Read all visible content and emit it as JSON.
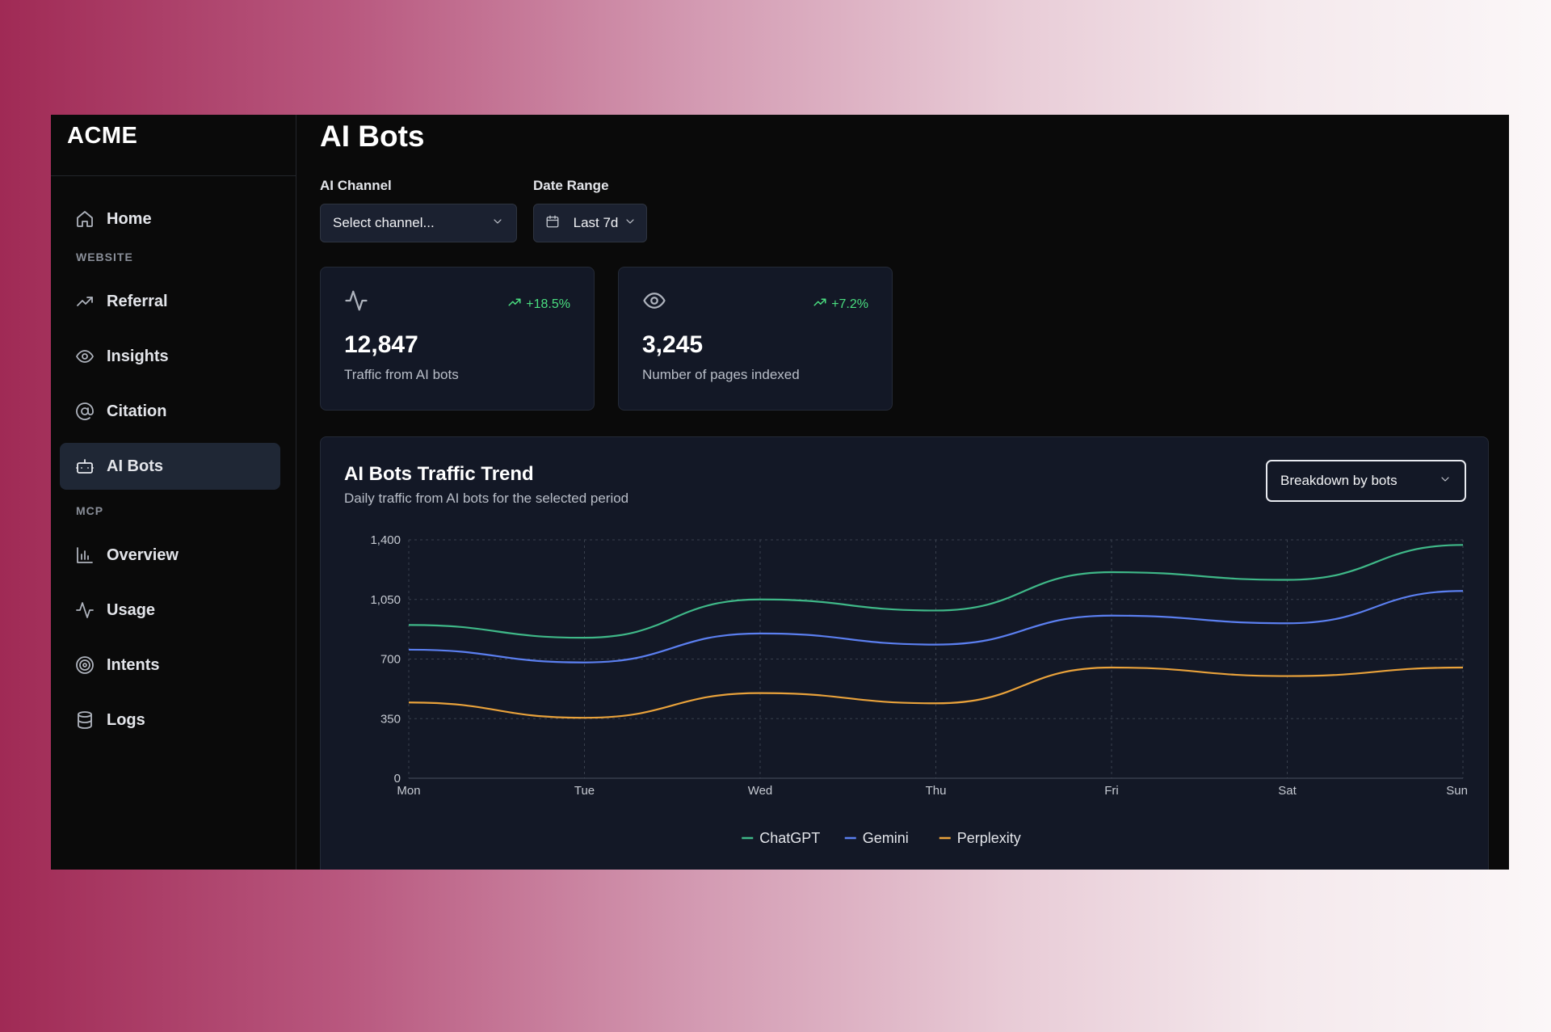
{
  "brand": {
    "name": "ACME"
  },
  "sidebar": {
    "items_top": [
      {
        "label": "Home",
        "icon": "home-icon"
      }
    ],
    "section_website": "WEBSITE",
    "website_items": [
      {
        "label": "Referral",
        "icon": "trending-up-icon"
      },
      {
        "label": "Insights",
        "icon": "eye-icon"
      },
      {
        "label": "Citation",
        "icon": "at-sign-icon"
      },
      {
        "label": "AI Bots",
        "icon": "bot-icon",
        "active": true
      }
    ],
    "section_mcp": "MCP",
    "mcp_items": [
      {
        "label": "Overview",
        "icon": "bar-chart-icon"
      },
      {
        "label": "Usage",
        "icon": "activity-icon"
      },
      {
        "label": "Intents",
        "icon": "target-icon"
      },
      {
        "label": "Logs",
        "icon": "database-icon"
      }
    ]
  },
  "page": {
    "title": "AI Bots"
  },
  "filters": {
    "channel_label": "AI Channel",
    "channel_placeholder": "Select channel...",
    "date_label": "Date Range",
    "date_value": "Last 7d"
  },
  "stats": [
    {
      "icon": "activity-icon",
      "change": "+18.5%",
      "value": "12,847",
      "label": "Traffic from AI bots"
    },
    {
      "icon": "eye-icon",
      "change": "+7.2%",
      "value": "3,245",
      "label": "Number of pages indexed"
    }
  ],
  "trend_card": {
    "title": "AI Bots Traffic Trend",
    "subtitle": "Daily traffic from AI bots for the selected period",
    "breakdown_label": "Breakdown by bots"
  },
  "colors": {
    "accent_positive": "#4ade80",
    "chatgpt": "#3fb888",
    "gemini": "#5b7ff0",
    "perplexity": "#e9a23b"
  },
  "chart_data": {
    "type": "line",
    "x": [
      "Mon",
      "Tue",
      "Wed",
      "Thu",
      "Fri",
      "Sat",
      "Sun"
    ],
    "y_ticks": [
      "0",
      "350",
      "700",
      "1,050",
      "1,400"
    ],
    "ylim": [
      0,
      1400
    ],
    "grid": true,
    "legend_position": "bottom",
    "series": [
      {
        "name": "ChatGPT",
        "color": "#3fb888",
        "values": [
          900,
          825,
          1050,
          985,
          1210,
          1165,
          1370
        ]
      },
      {
        "name": "Gemini",
        "color": "#5b7ff0",
        "values": [
          755,
          680,
          850,
          785,
          955,
          910,
          1100
        ]
      },
      {
        "name": "Perplexity",
        "color": "#e9a23b",
        "values": [
          445,
          355,
          500,
          440,
          650,
          600,
          650
        ]
      }
    ]
  }
}
